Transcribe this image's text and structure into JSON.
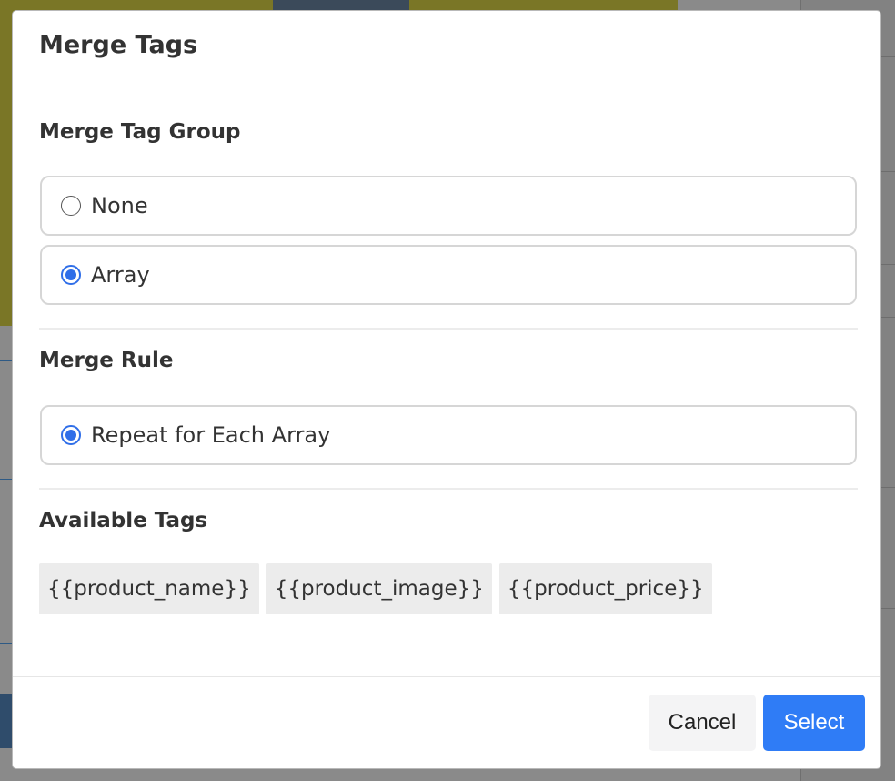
{
  "modal": {
    "title": "Merge Tags"
  },
  "merge_tag_group": {
    "heading": "Merge Tag Group",
    "options": [
      {
        "label": "None",
        "checked": false
      },
      {
        "label": "Array",
        "checked": true
      }
    ]
  },
  "merge_rule": {
    "heading": "Merge Rule",
    "options": [
      {
        "label": "Repeat for Each Array",
        "checked": true
      }
    ]
  },
  "available_tags": {
    "heading": "Available Tags",
    "tags": [
      "{{product_name}}",
      "{{product_image}}",
      "{{product_price}}"
    ]
  },
  "footer": {
    "cancel_label": "Cancel",
    "select_label": "Select"
  },
  "colors": {
    "accent": "#2f7cf6",
    "radio_checked": "#2f6ee8",
    "tag_background": "#ececec"
  }
}
